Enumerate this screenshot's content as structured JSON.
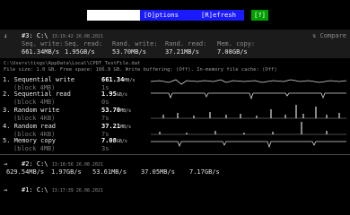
{
  "toolbar": {
    "options_label": "[O]ptions",
    "refresh_label": "[R]efresh",
    "help_label": "[?]",
    "blank_color": "#ffffff",
    "menu_color": "#1a1aff",
    "help_color": "#00a000"
  },
  "history_current": {
    "arrow": "↓",
    "title": "#3: C:\\",
    "timestamp": "13:19:42 26.08.2021",
    "compare_label": "⇅ Compare",
    "labels": [
      "Seq. write:",
      "Seq. read:",
      "Rand. write:",
      "Rand. read:",
      "Mem. copy:"
    ],
    "values": [
      "661.34MB/s",
      "1.95GB/s",
      "53.70MB/s",
      "37.21MB/s",
      "7.08GB/s"
    ]
  },
  "test_file": {
    "path": "C:\\Users\\tings\\AppData\\Local\\CPDT_TestFile.dat",
    "info": "File size: 1.0 GB. Free space: 166.9 GB. Write buffering: (Off). In-memory file cache: (Off)"
  },
  "tests": [
    {
      "name": "1. Sequential write",
      "sub": "(block 4MB)",
      "value": "661.34",
      "unit": "MB/s",
      "time": "1s",
      "spark": "seq-write"
    },
    {
      "name": "2. Sequential read",
      "sub": "(block 4MB)",
      "value": "1.95",
      "unit": "GB/s",
      "time": "0s",
      "spark": "seq-read"
    },
    {
      "name": "3. Random write",
      "sub": "(block 4KB)",
      "value": "53.70",
      "unit": "MB/s",
      "time": "7s",
      "spark": "rand-write"
    },
    {
      "name": "4. Random read",
      "sub": "(block 4KB)",
      "value": "37.21",
      "unit": "MB/s",
      "time": "7s",
      "spark": "rand-read"
    },
    {
      "name": "5. Memory copy",
      "sub": "(block 4MB)",
      "value": "7.08",
      "unit": "GB/s",
      "time": "3s",
      "spark": "mem-copy"
    }
  ],
  "history": [
    {
      "arrow": "→",
      "title": "#2: C:\\",
      "timestamp": "13:18:56 26.08.2021",
      "values": [
        "629.54MB/s",
        "1.97GB/s",
        "53.61MB/s",
        "37.05MB/s",
        "7.17GB/s"
      ]
    },
    {
      "arrow": "→",
      "title": "#1: C:\\",
      "timestamp": "13:17:39 26.08.2021",
      "values": []
    }
  ]
}
